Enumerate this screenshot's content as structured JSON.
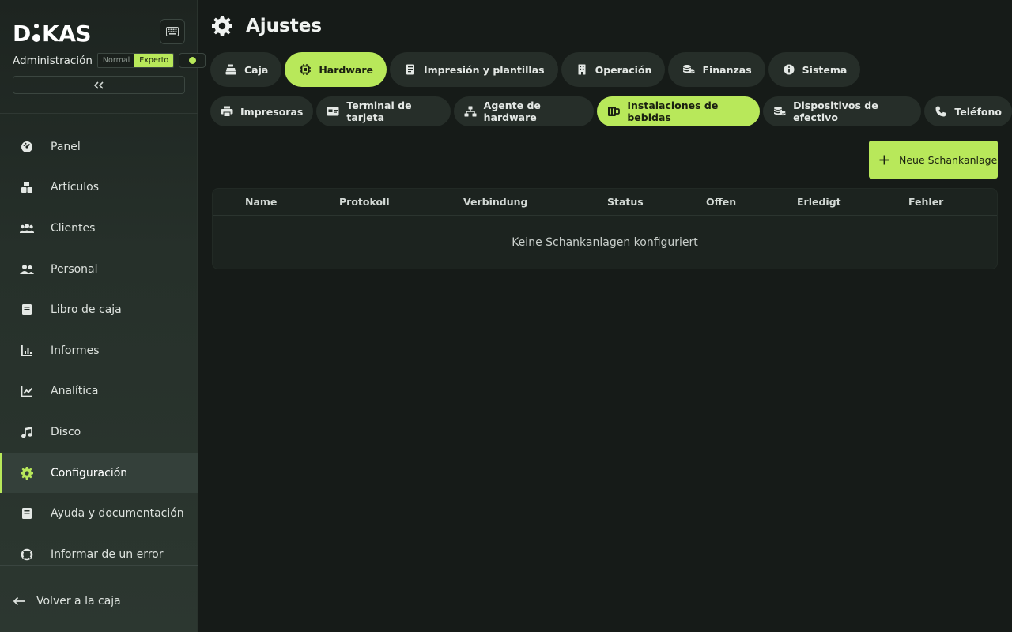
{
  "brand": {
    "logo": "DIKAS"
  },
  "sidebar": {
    "admin_label": "Administración",
    "mode_options": [
      "Normal",
      "Experto"
    ],
    "active_mode": "Experto",
    "items": [
      {
        "label": "Panel",
        "icon": "dashboard-icon"
      },
      {
        "label": "Artículos",
        "icon": "boxes-icon"
      },
      {
        "label": "Clientes",
        "icon": "users-icon"
      },
      {
        "label": "Personal",
        "icon": "staff-icon"
      },
      {
        "label": "Libro de caja",
        "icon": "book-icon"
      },
      {
        "label": "Informes",
        "icon": "bar-chart-icon"
      },
      {
        "label": "Analítica",
        "icon": "line-chart-icon"
      },
      {
        "label": "Disco",
        "icon": "music-icon"
      },
      {
        "label": "Configuración",
        "icon": "gear-icon",
        "active": true
      },
      {
        "label": "Ayuda y documentación",
        "icon": "book-icon"
      },
      {
        "label": "Informar de un error",
        "icon": "lifebuoy-icon"
      }
    ],
    "back_label": "Volver a la caja"
  },
  "header": {
    "title": "Ajustes"
  },
  "tabs": [
    {
      "label": "Caja",
      "icon": "register-icon"
    },
    {
      "label": "Hardware",
      "icon": "chip-icon",
      "active": true
    },
    {
      "label": "Impresión y plantillas",
      "icon": "document-icon"
    },
    {
      "label": "Operación",
      "icon": "building-icon"
    },
    {
      "label": "Finanzas",
      "icon": "coins-icon"
    },
    {
      "label": "Sistema",
      "icon": "info-icon"
    }
  ],
  "subtabs": [
    {
      "label": "Impresoras",
      "icon": "printer-icon"
    },
    {
      "label": "Terminal de tarjeta",
      "icon": "card-icon"
    },
    {
      "label": "Agente de hardware",
      "icon": "network-icon"
    },
    {
      "label": "Instalaciones de bebidas",
      "icon": "mug-icon",
      "active": true
    },
    {
      "label": "Dispositivos de efectivo",
      "icon": "coins-icon"
    },
    {
      "label": "Teléfono",
      "icon": "phone-icon"
    }
  ],
  "add_button": "Neue Schankanlage",
  "table": {
    "columns": [
      "Name",
      "Protokoll",
      "Verbindung",
      "Status",
      "Offen",
      "Erledigt",
      "Fehler"
    ],
    "empty_text": "Keine Schankanlagen konfiguriert"
  },
  "colors": {
    "accent": "#b8e85a",
    "background": "#161b18",
    "sidebar": "#1d2420"
  }
}
